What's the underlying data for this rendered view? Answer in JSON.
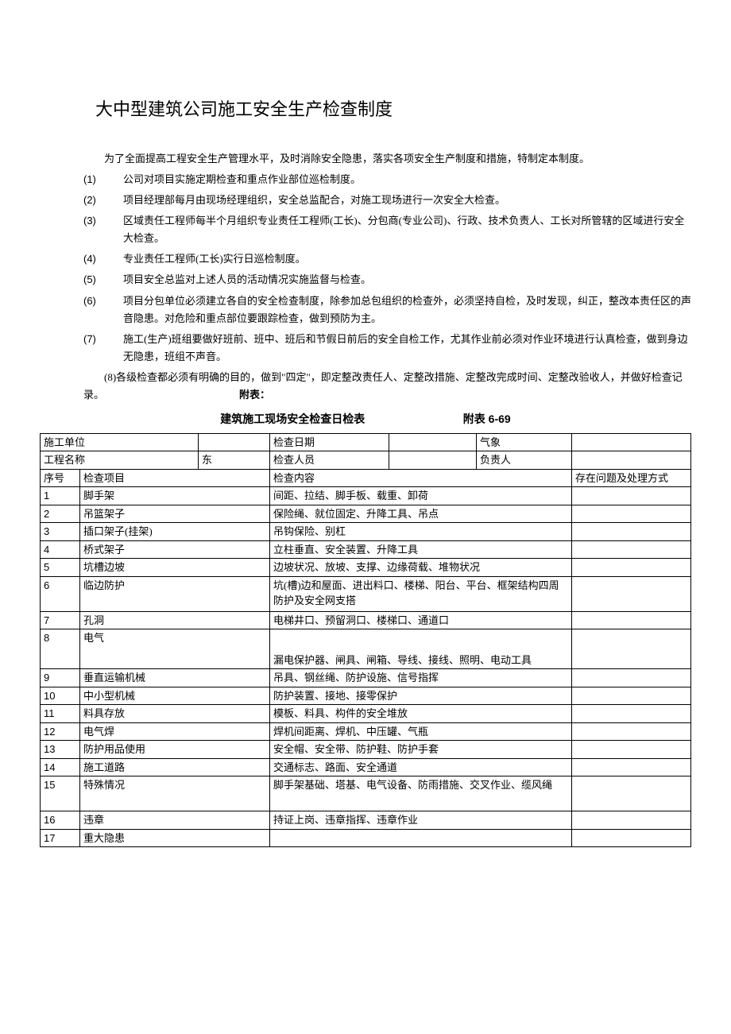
{
  "title": "大中型建筑公司施工安全生产检查制度",
  "intro": "为了全面提高工程安全生产管理水平，及时消除安全隐患，落实各项安全生产制度和措施，特制定本制度。",
  "items": [
    {
      "num": "(1)",
      "text": "公司对项目实施定期检查和重点作业部位巡检制度。"
    },
    {
      "num": "(2)",
      "text": "项目经理部每月由现场经理组织，安全总监配合，对施工现场进行一次安全大检查。"
    },
    {
      "num": "(3)",
      "text": "区域责任工程师每半个月组织专业责任工程师(工长)、分包商(专业公司)、行政、技术负责人、工长对所管辖的区域进行安全大检查。"
    },
    {
      "num": "(4)",
      "text": "专业责任工程师(工长)实行日巡检制度。"
    },
    {
      "num": "(5)",
      "text": "项目安全总监对上述人员的活动情况实施监督与检查。"
    },
    {
      "num": "(6)",
      "text": "项目分包单位必须建立各自的安全检查制度，除参加总包组织的检查外，必须坚持自检，及时发现，纠正，整改本责任区的声音隐患。对危险和重点部位要跟踪检查，做到预防为主。"
    },
    {
      "num": "(7)",
      "text": "施工(生产)班组要做好班前、班中、班后和节假日前后的安全自检工作，尤其作业前必须对作业环境进行认真检查，做到身边无隐患，班组不声音。"
    }
  ],
  "item8_prefix": "(8)各级检查都必须有明确的目的，做到\"四定\"，即定整改责任人、定整改措施、定整改完成时间、定整改验收人，并做好检查记录。",
  "appendix_label": "附表：",
  "table_title": "建筑施工现场安全检查日检表",
  "table_num_prefix": "附表",
  "table_num": "6-69",
  "header1": {
    "unit_label": "施工单位",
    "date_label": "检查日期",
    "weather_label": "气象",
    "project_label": "工程名称",
    "project_value": "东",
    "inspector_label": "检查人员",
    "owner_label": "负责人"
  },
  "cols": {
    "seq": "序号",
    "item": "检查项目",
    "content": "检查内容",
    "issue": "存在问题及处理方式"
  },
  "rows": [
    {
      "seq": "1",
      "item": "脚手架",
      "content": "间距、拉结、脚手板、载重、卸荷"
    },
    {
      "seq": "2",
      "item": "吊篮架子",
      "content": "保险绳、就位固定、升降工具、吊点"
    },
    {
      "seq": "3",
      "item": "插口架子(挂架)",
      "content": "吊钩保险、别杠"
    },
    {
      "seq": "4",
      "item": "桥式架子",
      "content": "立柱垂直、安全装置、升降工具"
    },
    {
      "seq": "5",
      "item": "坑槽边坡",
      "content": "边坡状况、放坡、支撑、边缘荷载、堆物状况"
    },
    {
      "seq": "6",
      "item": "临边防护",
      "content": "坑(槽)边和屋面、进出料口、楼梯、阳台、平台、框架结构四周防护及安全网支搭"
    },
    {
      "seq": "7",
      "item": "孔洞",
      "content": "电梯井口、预留洞口、楼梯口、通道口"
    },
    {
      "seq": "8",
      "item": "电气",
      "content": "漏电保护器、闸具、闸箱、导线、接线、照明、电动工具"
    },
    {
      "seq": "9",
      "item": "垂直运输机械",
      "content": "吊具、钢丝绳、防护设施、信号指挥"
    },
    {
      "seq": "10",
      "item": "中小型机械",
      "content": "防护装置、接地、接零保护"
    },
    {
      "seq": "11",
      "item": "料具存放",
      "content": "模板、料具、构件的安全堆放"
    },
    {
      "seq": "12",
      "item": "电气焊",
      "content": "焊机间距离、焊机、中压罐、气瓶"
    },
    {
      "seq": "13",
      "item": "防护用品使用",
      "content": "安全帽、安全带、防护鞋、防护手套"
    },
    {
      "seq": "14",
      "item": "施工道路",
      "content": "交通标志、路面、安全通道"
    },
    {
      "seq": "15",
      "item": "特殊情况",
      "content": "脚手架基础、塔基、电气设备、防雨措施、交叉作业、缆风绳"
    },
    {
      "seq": "16",
      "item": "违章",
      "content": "持证上岗、违章指挥、违章作业"
    },
    {
      "seq": "17",
      "item": "重大隐患",
      "content": ""
    }
  ]
}
